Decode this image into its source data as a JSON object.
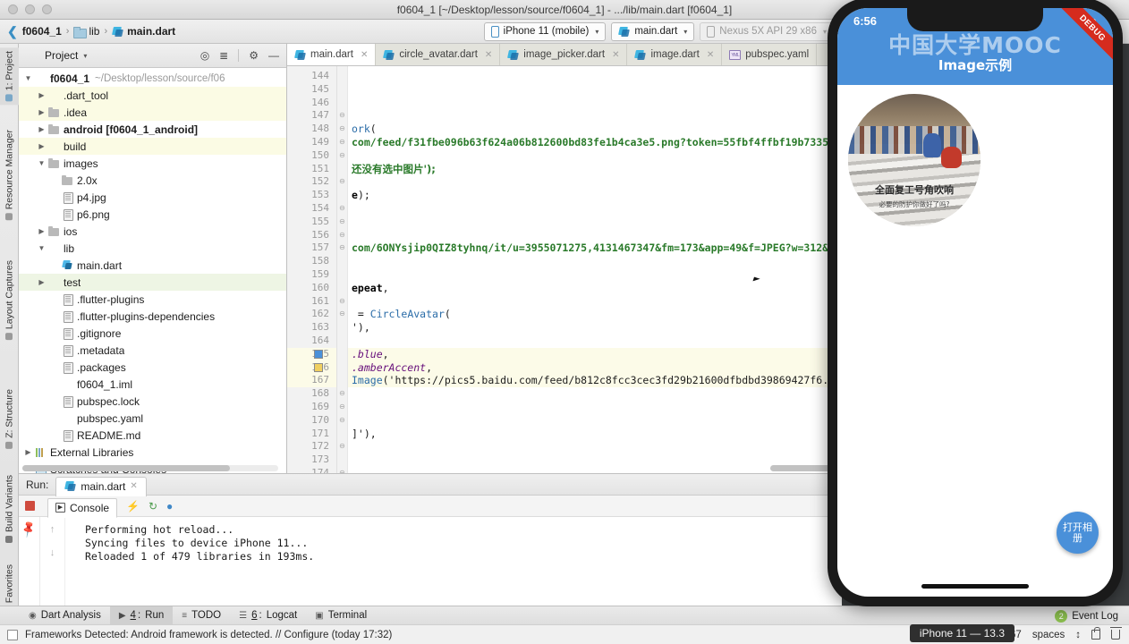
{
  "window": {
    "title": "f0604_1 [~/Desktop/lesson/source/f0604_1] - .../lib/main.dart [f0604_1]"
  },
  "breadcrumb": {
    "back_icon": "back-chevron-icon",
    "items": [
      "f0604_1",
      "lib",
      "main.dart"
    ],
    "separator": "›"
  },
  "toolbar": {
    "device_combo": "iPhone 11 (mobile)",
    "config_combo": "main.dart",
    "emulator_combo": "Nexus 5X API 29 x86",
    "caret": "▾"
  },
  "left_strip": {
    "items": [
      "1: Project",
      "Resource Manager",
      "Layout Captures",
      "Z: Structure",
      "Build Variants",
      "Favorites"
    ]
  },
  "project_panel": {
    "title": "Project",
    "caret": "▾",
    "icons": [
      "locate-icon",
      "collapse-all-icon",
      "settings-gear-icon",
      "hide-panel-icon"
    ],
    "tree": [
      {
        "label": "f0604_1",
        "sub": "~/Desktop/lesson/source/f06",
        "indent": 0,
        "arrow": "open",
        "icon": "folder-blue",
        "bold": true,
        "hl": ""
      },
      {
        "label": ".dart_tool",
        "sub": "",
        "indent": 1,
        "arrow": "closed",
        "icon": "folder-red",
        "bold": false,
        "hl": "hl-yellow"
      },
      {
        "label": ".idea",
        "sub": "",
        "indent": 1,
        "arrow": "closed",
        "icon": "folder",
        "bold": false,
        "hl": "hl-yellow"
      },
      {
        "label": "android [f0604_1_android]",
        "sub": "",
        "indent": 1,
        "arrow": "closed",
        "icon": "folder",
        "bold": true,
        "hl": ""
      },
      {
        "label": "build",
        "sub": "",
        "indent": 1,
        "arrow": "closed",
        "icon": "folder-orange",
        "bold": false,
        "hl": "hl-yellow"
      },
      {
        "label": "images",
        "sub": "",
        "indent": 1,
        "arrow": "open",
        "icon": "folder",
        "bold": false,
        "hl": ""
      },
      {
        "label": "2.0x",
        "sub": "",
        "indent": 2,
        "arrow": "none",
        "icon": "folder",
        "bold": false,
        "hl": ""
      },
      {
        "label": "p4.jpg",
        "sub": "",
        "indent": 2,
        "arrow": "none",
        "icon": "file",
        "bold": false,
        "hl": ""
      },
      {
        "label": "p6.png",
        "sub": "",
        "indent": 2,
        "arrow": "none",
        "icon": "file",
        "bold": false,
        "hl": ""
      },
      {
        "label": "ios",
        "sub": "",
        "indent": 1,
        "arrow": "closed",
        "icon": "folder",
        "bold": false,
        "hl": ""
      },
      {
        "label": "lib",
        "sub": "",
        "indent": 1,
        "arrow": "open",
        "icon": "folder-blue",
        "bold": false,
        "hl": ""
      },
      {
        "label": "main.dart",
        "sub": "",
        "indent": 2,
        "arrow": "none",
        "icon": "dart",
        "bold": false,
        "hl": ""
      },
      {
        "label": "test",
        "sub": "",
        "indent": 1,
        "arrow": "closed",
        "icon": "folder-green",
        "bold": false,
        "hl": "hl-green"
      },
      {
        "label": ".flutter-plugins",
        "sub": "",
        "indent": 2,
        "arrow": "none",
        "icon": "file",
        "bold": false,
        "hl": ""
      },
      {
        "label": ".flutter-plugins-dependencies",
        "sub": "",
        "indent": 2,
        "arrow": "none",
        "icon": "file",
        "bold": false,
        "hl": ""
      },
      {
        "label": ".gitignore",
        "sub": "",
        "indent": 2,
        "arrow": "none",
        "icon": "file",
        "bold": false,
        "hl": ""
      },
      {
        "label": ".metadata",
        "sub": "",
        "indent": 2,
        "arrow": "none",
        "icon": "file",
        "bold": false,
        "hl": ""
      },
      {
        "label": ".packages",
        "sub": "",
        "indent": 2,
        "arrow": "none",
        "icon": "file",
        "bold": false,
        "hl": ""
      },
      {
        "label": "f0604_1.iml",
        "sub": "",
        "indent": 2,
        "arrow": "none",
        "icon": "iml",
        "bold": false,
        "hl": ""
      },
      {
        "label": "pubspec.lock",
        "sub": "",
        "indent": 2,
        "arrow": "none",
        "icon": "file",
        "bold": false,
        "hl": ""
      },
      {
        "label": "pubspec.yaml",
        "sub": "",
        "indent": 2,
        "arrow": "none",
        "icon": "yml",
        "bold": false,
        "hl": ""
      },
      {
        "label": "README.md",
        "sub": "",
        "indent": 2,
        "arrow": "none",
        "icon": "file",
        "bold": false,
        "hl": ""
      },
      {
        "label": "External Libraries",
        "sub": "",
        "indent": 0,
        "arrow": "closed",
        "icon": "lib",
        "bold": false,
        "hl": ""
      },
      {
        "label": "Scratches and Consoles",
        "sub": "",
        "indent": 0,
        "arrow": "none",
        "icon": "scratch",
        "bold": false,
        "hl": ""
      }
    ]
  },
  "editor": {
    "tabs": [
      {
        "label": "main.dart",
        "icon": "dart-icon",
        "active": true,
        "closable": true
      },
      {
        "label": "circle_avatar.dart",
        "icon": "dart-icon",
        "active": false,
        "closable": true
      },
      {
        "label": "image_picker.dart",
        "icon": "dart-icon",
        "active": false,
        "closable": true
      },
      {
        "label": "image.dart",
        "icon": "dart-icon",
        "active": false,
        "closable": true
      },
      {
        "label": "pubspec.yaml",
        "icon": "yaml-icon",
        "active": false,
        "closable": false
      }
    ],
    "first_line": 144,
    "last_line": 174,
    "highlight_lines": [
      165,
      166,
      167
    ],
    "color_swatches": [
      {
        "line": 165,
        "color": "#4a90d9"
      },
      {
        "line": 166,
        "color": "#f0cf60"
      }
    ],
    "lines": [
      {
        "n": 144,
        "text": ""
      },
      {
        "n": 145,
        "text": ""
      },
      {
        "n": 146,
        "text": ""
      },
      {
        "n": 147,
        "text": ""
      },
      {
        "n": 148,
        "text": "ork("
      },
      {
        "n": 149,
        "text": "com/feed/f31fbe096b63f624a06b812600bd83fe1b4ca3e5.png?token=55fbf4ffbf19b7335"
      },
      {
        "n": 150,
        "text": ""
      },
      {
        "n": 151,
        "text": "还没有选中图片');"
      },
      {
        "n": 152,
        "text": ""
      },
      {
        "n": 153,
        "text": "e);"
      },
      {
        "n": 154,
        "text": ""
      },
      {
        "n": 155,
        "text": ""
      },
      {
        "n": 156,
        "text": ""
      },
      {
        "n": 157,
        "text": "com/6ONYsjip0QIZ8tyhnq/it/u=3955071275,4131467347&fm=173&app=49&f=JPEG?w=312&"
      },
      {
        "n": 158,
        "text": ""
      },
      {
        "n": 159,
        "text": ""
      },
      {
        "n": 160,
        "text": "epeat,"
      },
      {
        "n": 161,
        "text": ""
      },
      {
        "n": 162,
        "text": " = CircleAvatar("
      },
      {
        "n": 163,
        "text": "'),"
      },
      {
        "n": 164,
        "text": ""
      },
      {
        "n": 165,
        "text": ".blue,"
      },
      {
        "n": 166,
        "text": ".amberAccent,"
      },
      {
        "n": 167,
        "text": "Image('https://pics5.baidu.com/feed/b812c8fcc3cec3fd29b21600dfbdbd39869427f6."
      },
      {
        "n": 168,
        "text": ""
      },
      {
        "n": 169,
        "text": ""
      },
      {
        "n": 170,
        "text": ""
      },
      {
        "n": 171,
        "text": "]'),"
      },
      {
        "n": 172,
        "text": ""
      },
      {
        "n": 173,
        "text": ""
      },
      {
        "n": 174,
        "text": ""
      }
    ]
  },
  "run_panel": {
    "run_label": "Run:",
    "run_tab": "main.dart",
    "console_tab": "Console",
    "console_icons": [
      "lightning-icon",
      "restart-icon",
      "flutter-icon"
    ],
    "stop_icon": "stop-icon",
    "pin_icon": "pin-icon",
    "scroll_up_icon": "arrow-up-icon",
    "scroll_down_icon": "arrow-down-icon",
    "output": [
      "Performing hot reload...",
      "Syncing files to device iPhone 11...",
      "Reloaded 1 of 479 libraries in 193ms."
    ]
  },
  "bottom_bar": {
    "items": [
      {
        "label": "Dart Analysis",
        "icon": "dart-analysis-icon",
        "selected": false,
        "accel": ""
      },
      {
        "label": "Run",
        "icon": "run-icon",
        "selected": true,
        "accel": "4"
      },
      {
        "label": "TODO",
        "icon": "todo-icon",
        "selected": false,
        "accel": ""
      },
      {
        "label": "Logcat",
        "icon": "logcat-icon",
        "selected": false,
        "accel": "6"
      },
      {
        "label": "Terminal",
        "icon": "terminal-icon",
        "selected": false,
        "accel": ""
      }
    ],
    "event_log": "Event Log",
    "event_log_badge": "2"
  },
  "status_bar": {
    "message": "Frameworks Detected: Android framework is detected. // Configure (today 17:32)",
    "caret_pos": "167",
    "indent": "spaces",
    "indent_caret": "↕",
    "tooltip": "iPhone 11 — 13.3",
    "lock_icon": "lock-icon",
    "trash_icon": "trash-icon"
  },
  "simulator": {
    "status_time": "6:56",
    "wifi_icon": "wifi-icon",
    "debug_ribbon": "DEBUG",
    "watermark": "中国大学MOOC",
    "appbar_title": "Image示例",
    "appbar_color": "#4a90d9",
    "avatar_caption_main": "全面复工号角吹响",
    "avatar_caption_sub": "必要的防护你做好了吗?",
    "fab_label": "打开相册",
    "fab_color": "#4a90d9",
    "home_indicator": "home-indicator"
  }
}
